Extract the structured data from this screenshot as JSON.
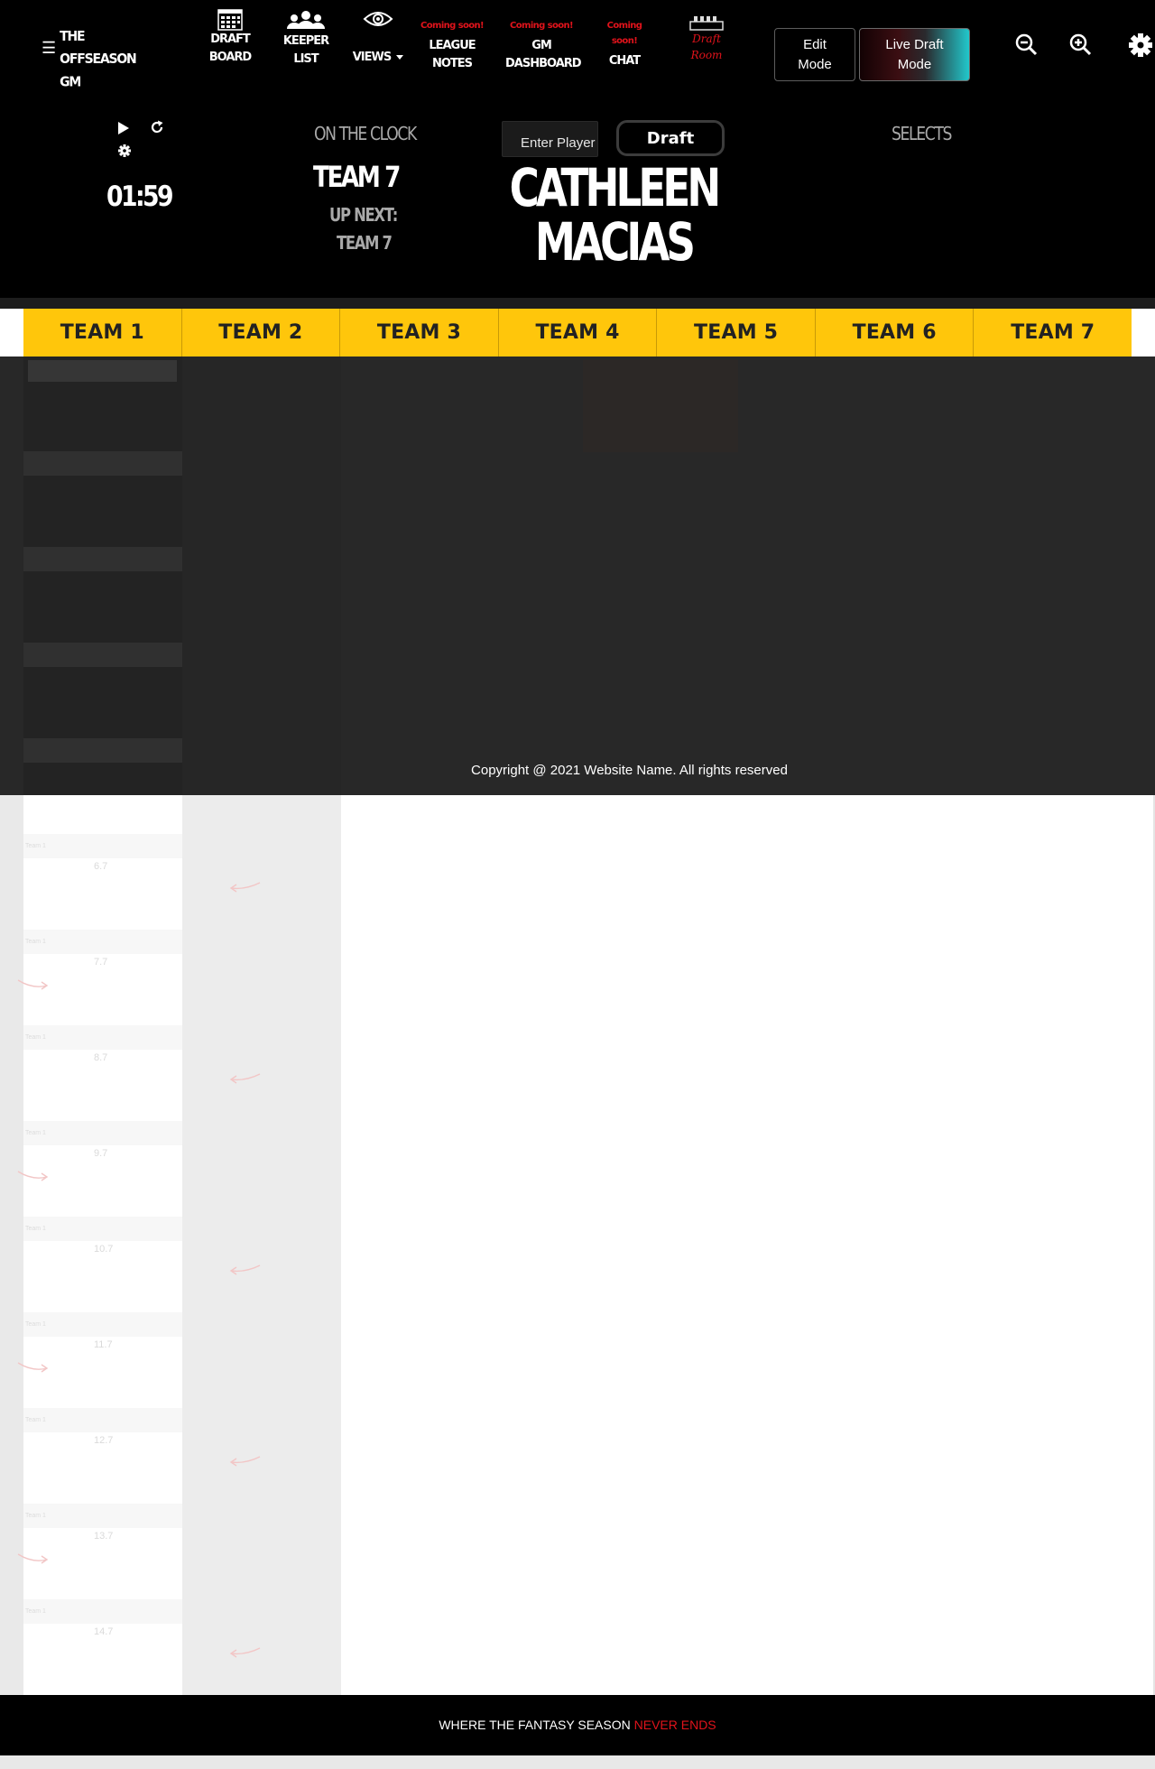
{
  "brand": {
    "lines": [
      "THE",
      "OFFSEASON",
      "GM"
    ],
    "menu_icon": "hamburger-menu-icon"
  },
  "nav": {
    "draft_board": {
      "label": "DRAFT\nBOARD",
      "icon": "calendar-grid-icon"
    },
    "keeper_list": {
      "label": "KEEPER\nLIST",
      "icon": "people-group-icon"
    },
    "views": {
      "label": "VIEWS",
      "icon": "eye-icon"
    },
    "league_notes": {
      "badge": "Coming soon!",
      "label": "LEAGUE\nNOTES"
    },
    "gm_dashboard": {
      "badge": "Coming soon!",
      "label": "GM\nDASHBOARD"
    },
    "chat": {
      "badge": "Coming\nsoon!",
      "label": "CHAT"
    },
    "draft_room": {
      "label": "Draft\nRoom",
      "icon": "draft-room-table-icon"
    }
  },
  "modes": {
    "edit": "Edit\nMode",
    "live_draft": "Live Draft\nMode"
  },
  "tools": {
    "zoom_out": "zoom-out-icon",
    "zoom_in": "zoom-in-icon",
    "settings": "gear-icon"
  },
  "clock": {
    "timer": "01:59",
    "on_the_clock_label": "ON THE CLOCK",
    "on_the_clock_team": "TEAM 7",
    "up_next_label": "UP NEXT:",
    "up_next_team": "TEAM 7"
  },
  "draft": {
    "input_placeholder": "Enter Player",
    "button_label": "Draft",
    "player_name_line1": "CATHLEEN",
    "player_name_line2": "MACIAS"
  },
  "selects_label": "SELECTS",
  "teams": [
    "TEAM 1",
    "TEAM 2",
    "TEAM 3",
    "TEAM 4",
    "TEAM 5",
    "TEAM 6",
    "TEAM 7"
  ],
  "board": {
    "ghost_team_label": "Team 1",
    "ghost_picks": [
      "6.7",
      "7.7",
      "8.7",
      "9.7",
      "10.7",
      "11.7",
      "12.7",
      "13.7",
      "14.7"
    ]
  },
  "copyright": "Copyright @ 2021 Website Name. All rights reserved",
  "footer": {
    "tagline_pre": "WHERE THE FANTASY SEASON ",
    "tagline_highlight": "NEVER ENDS"
  },
  "colors": {
    "accent_yellow": "#ffc60b",
    "accent_red": "#e0131b",
    "live_gradient_end": "#22c8cc"
  }
}
